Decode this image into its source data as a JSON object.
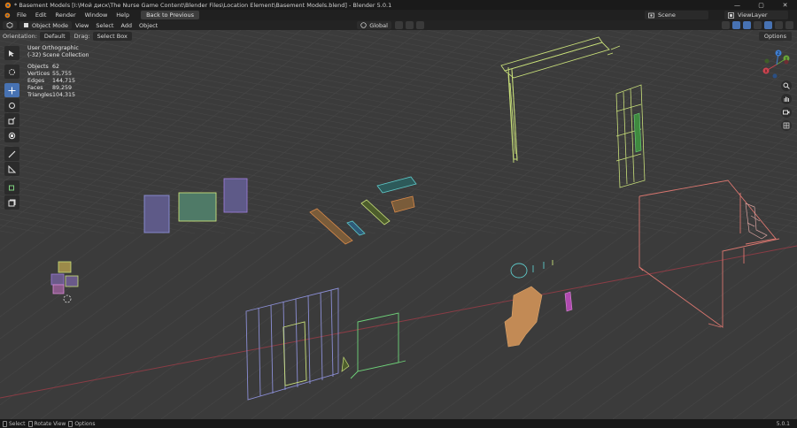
{
  "window": {
    "title": "* Basement Models [I:\\Мой диск\\The Nurse Game Content\\Blender Files\\Location Element\\Basement Models.blend] - Blender 5.0.1",
    "controls": [
      "—",
      "▢",
      "✕"
    ]
  },
  "menubar": {
    "items": [
      "File",
      "Edit",
      "Render",
      "Window",
      "Help"
    ],
    "back_button": "Back to Previous",
    "scene_label": "Scene",
    "view_layer_label": "ViewLayer"
  },
  "header": {
    "mode": "Object Mode",
    "menus": [
      "View",
      "Select",
      "Add",
      "Object"
    ],
    "transform_orientation": "Global"
  },
  "tool_settings": {
    "orientation_label": "Orientation:",
    "orientation_value": "Default",
    "drag_label": "Drag:",
    "drag_value": "Select Box",
    "options_label": "Options"
  },
  "viewport_info": {
    "view_name": "User Orthographic",
    "collection": "(-32) Scene Collection",
    "stats": [
      {
        "label": "Objects",
        "value": "62"
      },
      {
        "label": "Vertices",
        "value": "55,755"
      },
      {
        "label": "Edges",
        "value": "144,715"
      },
      {
        "label": "Faces",
        "value": "89,259"
      },
      {
        "label": "Triangles",
        "value": "104,315"
      }
    ]
  },
  "gizmo": {
    "x_label": "X",
    "y_label": "Y",
    "z_label": "Z"
  },
  "toolbar": {
    "tools": [
      "select-box-icon",
      "cursor-icon",
      "move-icon",
      "rotate-icon",
      "scale-icon",
      "transform-icon",
      "annotate-icon",
      "measure-icon",
      "add-cube-icon",
      "add-object-icon"
    ]
  },
  "statusbar": {
    "items": [
      "Select",
      "Rotate View",
      "Options"
    ],
    "version": "5.0.1"
  },
  "colors": {
    "viewport_bg": "#3b3b3b",
    "grid": "#454545",
    "x_axis": "#8a3c45",
    "active_tool": "#4772b3",
    "wire_yellow": "#c9e07a",
    "wire_blue": "#8c8fd6",
    "wire_green": "#6fd37a",
    "wire_red": "#d9766f",
    "wire_cyan": "#5ec9c9",
    "wire_orange": "#d98a4a"
  }
}
